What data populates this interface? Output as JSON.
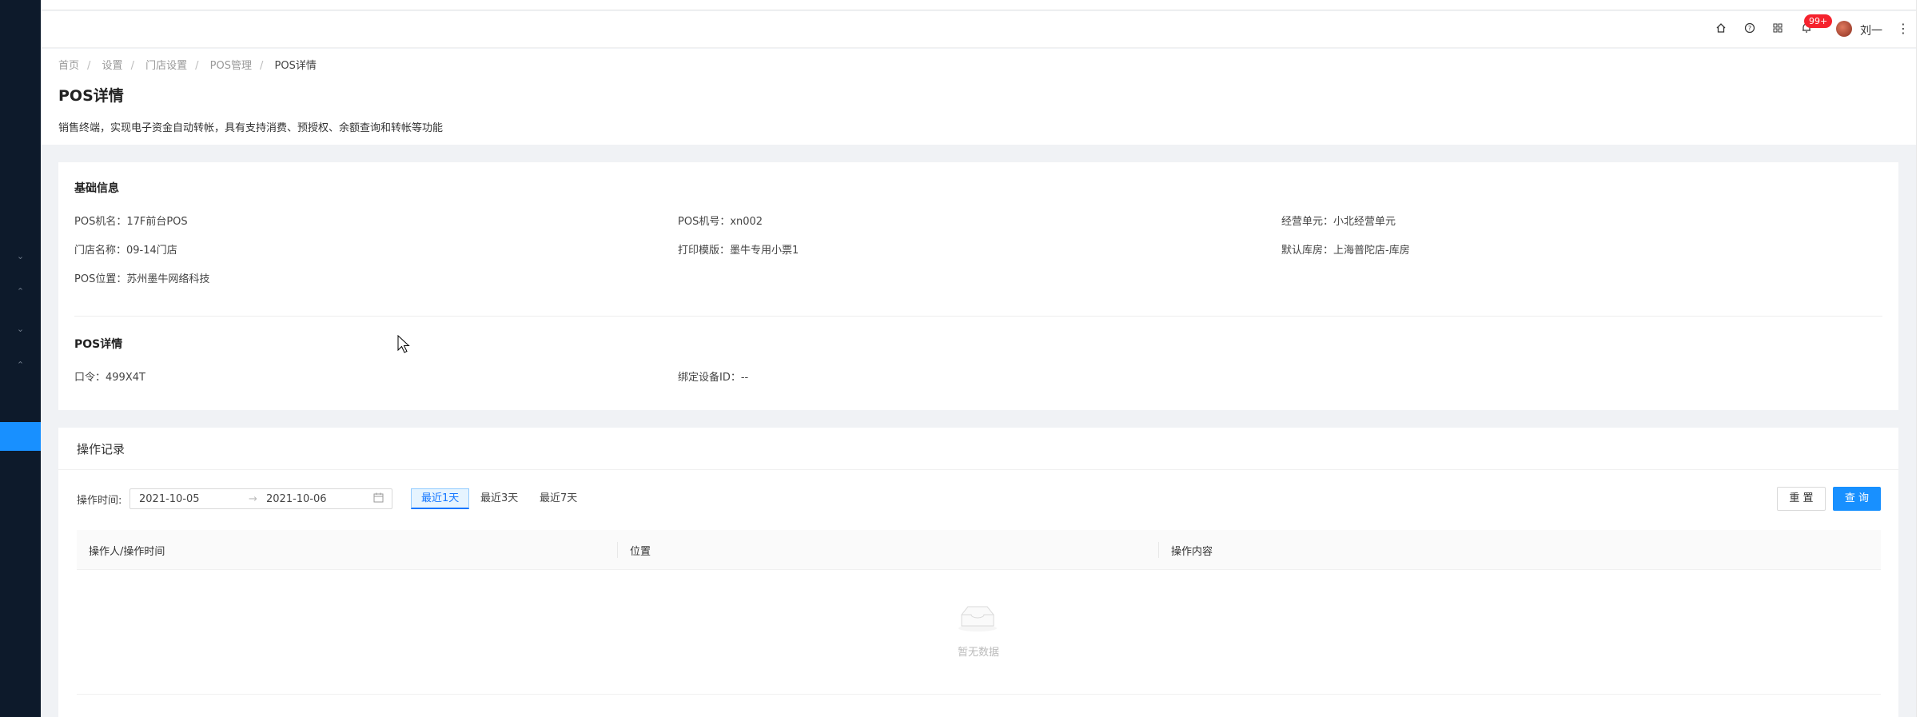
{
  "header": {
    "badge": "99+",
    "user_name": "刘一",
    "icons": [
      "home-icon",
      "help-icon",
      "apps-icon",
      "bell-icon",
      "more-icon"
    ]
  },
  "breadcrumb": [
    "首页",
    "设置",
    "门店设置",
    "POS管理",
    "POS详情"
  ],
  "page": {
    "title": "POS详情",
    "description": "销售终端，实现电子资金自动转帐，具有支持消费、预授权、余额查询和转帐等功能"
  },
  "basic_info": {
    "title": "基础信息",
    "pos_name": "POS机名：17F前台POS",
    "pos_no": "POS机号：xn002",
    "business_unit": "经营单元：小北经营单元",
    "store_name": "门店名称：09-14门店",
    "print_template": "打印模版：墨牛专用小票1",
    "default_warehouse": "默认库房：上海普陀店-库房",
    "pos_location": "POS位置：苏州墨牛网络科技"
  },
  "pos_detail": {
    "title": "POS详情",
    "password": "口令：499X4T",
    "device_id": "绑定设备ID：--"
  },
  "records": {
    "title": "操作记录",
    "time_label": "操作时间:",
    "start_date": "2021-10-05",
    "end_date": "2021-10-06",
    "quick_ranges": [
      "最近1天",
      "最近3天",
      "最近7天"
    ],
    "reset_label": "重 置",
    "query_label": "查 询",
    "columns": [
      "操作人/操作时间",
      "位置",
      "操作内容"
    ],
    "empty_text": "暂无数据"
  },
  "colors": {
    "sidebar": "#0d1a2b",
    "primary": "#1890ff",
    "badge": "#f5222d"
  }
}
